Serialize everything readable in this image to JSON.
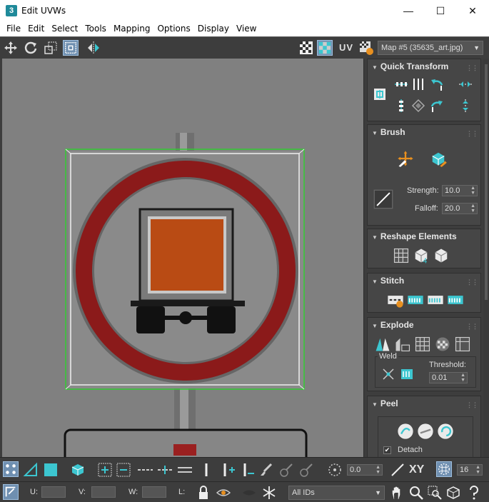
{
  "window": {
    "app_icon": "3",
    "title": "Edit UVWs",
    "minimize": "—",
    "maximize": "☐",
    "close": "✕"
  },
  "menu": [
    "File",
    "Edit",
    "Select",
    "Tools",
    "Mapping",
    "Options",
    "Display",
    "View"
  ],
  "toolbar": {
    "uv_label": "UV",
    "map_select": "Map #5 (35635_art.jpg)"
  },
  "panels": {
    "quick_transform": {
      "title": "Quick Transform"
    },
    "brush": {
      "title": "Brush",
      "strength_label": "Strength:",
      "strength_value": "10.0",
      "falloff_label": "Falloff:",
      "falloff_value": "20.0"
    },
    "reshape": {
      "title": "Reshape Elements"
    },
    "stitch": {
      "title": "Stitch"
    },
    "explode": {
      "title": "Explode",
      "weld_label": "Weld",
      "threshold_label": "Threshold:",
      "threshold_value": "0.01"
    },
    "peel": {
      "title": "Peel",
      "detach_label": "Detach",
      "detach_checked": true
    }
  },
  "bottom": {
    "rotation_value": "0.0",
    "xy_label": "XY",
    "grid_value": "16",
    "u_label": "U:",
    "v_label": "V:",
    "w_label": "W:",
    "l_label": "L:",
    "ids_select": "All IDs"
  },
  "colors": {
    "accent": "#3cc6d0",
    "panel_bg": "#464646",
    "viewport_bg": "#808080",
    "uv_frame": "#33cc33",
    "sign_red": "#8b1a1a",
    "sign_box": "#b94b14"
  }
}
